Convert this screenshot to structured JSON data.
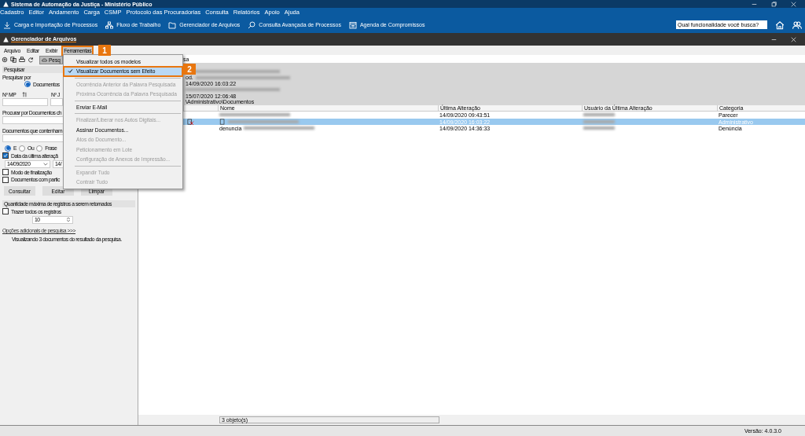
{
  "app": {
    "title": "Sistema de Automação da Justiça - Ministério Público"
  },
  "menu": [
    "Cadastro",
    "Editor",
    "Andamento",
    "Carga",
    "CSMP",
    "Protocolo das Procuradorias",
    "Consulta",
    "Relatórios",
    "Apoio",
    "Ajuda"
  ],
  "toolbar": [
    {
      "label": "Carga e Importação de Processos",
      "kind": "import"
    },
    {
      "label": "Fluxo de Trabalho",
      "kind": "flow"
    },
    {
      "label": "Gerenciador de Arquivos",
      "kind": "folder"
    },
    {
      "label": "Consulta Avançada de Processos",
      "kind": "search"
    },
    {
      "label": "Agenda de Compromissos",
      "kind": "calendar"
    }
  ],
  "search": {
    "placeholder": "Qual funcionalidade você busca?"
  },
  "child_window": {
    "title": "Gerenciador de Arquivos",
    "tool_label": "Pesq",
    "menu": [
      {
        "label": "Arquivo",
        "selected": false
      },
      {
        "label": "Editar",
        "selected": false
      },
      {
        "label": "Exibir",
        "selected": false
      },
      {
        "label": "Ferramentas",
        "selected": true
      }
    ]
  },
  "callouts": [
    "1",
    "2"
  ],
  "tools_menu": [
    {
      "kind": "item",
      "label": "Visualizar todos os modelos",
      "disabled": false,
      "checked": false,
      "selected": false
    },
    {
      "kind": "item",
      "label": "Visualizar Documentos sem Efeito",
      "disabled": false,
      "checked": true,
      "selected": true
    },
    {
      "kind": "separator"
    },
    {
      "kind": "item",
      "label": "Ocorrência Anterior da Palavra Pesquisada",
      "disabled": true,
      "checked": false,
      "selected": false
    },
    {
      "kind": "item",
      "label": "Próxima Ocorrência da Palavra Pesquisada",
      "disabled": true,
      "checked": false,
      "selected": false
    },
    {
      "kind": "separator"
    },
    {
      "kind": "item",
      "label": "Enviar E-Mail",
      "disabled": false,
      "checked": false,
      "selected": false
    },
    {
      "kind": "separator"
    },
    {
      "kind": "item",
      "label": "Finalizar/Liberar nos Autos Digitais...",
      "disabled": true,
      "checked": false,
      "selected": false
    },
    {
      "kind": "item",
      "label": "Assinar Documentos...",
      "disabled": false,
      "checked": false,
      "selected": false
    },
    {
      "kind": "item",
      "label": "Atos do Documento...",
      "disabled": true,
      "checked": false,
      "selected": false
    },
    {
      "kind": "item",
      "label": "Peticionamento em Lote",
      "disabled": true,
      "checked": false,
      "selected": false
    },
    {
      "kind": "item",
      "label": "Configuração de Anexos de Impressão...",
      "disabled": true,
      "checked": false,
      "selected": false
    },
    {
      "kind": "separator"
    },
    {
      "kind": "item",
      "label": "Expandir Tudo",
      "disabled": true,
      "checked": false,
      "selected": false
    },
    {
      "kind": "item",
      "label": "Contrair Tudo",
      "disabled": true,
      "checked": false,
      "selected": false
    }
  ],
  "search_panel": {
    "header": "Pesquisar",
    "group_label": "Pesquisar por",
    "search_by": [
      {
        "label": "Documentos",
        "selected": true
      }
    ],
    "mp_label": "Nº MP",
    "j_label": "Nº J",
    "contains_label": "Procurar por Documentos ch",
    "words_label": "Documentos que contenham",
    "modes": [
      {
        "label": "E",
        "selected": true
      },
      {
        "label": "Ou",
        "selected": false
      },
      {
        "label": "Frase",
        "selected": false
      }
    ],
    "date_check": {
      "label": "Data da última alteraçã",
      "checked": true
    },
    "date_from": "14/09/2020",
    "date_to": "14/",
    "checks": [
      {
        "label": "Modo de finalização",
        "checked": false
      },
      {
        "label": "Documentos com partic",
        "checked": false
      }
    ],
    "buttons": [
      "Consultar",
      "Editar",
      "Limpar"
    ],
    "max_header": "Quantidade máxima de registros a serem retornados",
    "all_records": {
      "label": "Trazer todos os registros",
      "checked": false
    },
    "max_value": "10",
    "more_link": "Opções adicionais de pesquisa >>>",
    "result_text": "Visualizando 3 documentos do resultado da pesquisa."
  },
  "search_strip": "sa",
  "details": [
    {
      "redacted": true
    },
    {
      "text": "od.",
      "redacted": true
    },
    {
      "text": "14/09/2020 16:03:22",
      "redacted": false
    },
    {
      "redacted": true
    },
    {
      "text": "15/07/2020 12:06:48",
      "redacted": false
    },
    {
      "text": "\\Administrativo\\Documentos",
      "redacted": false
    }
  ],
  "table": {
    "columns": [
      "Nome",
      "Última Alteração",
      "Usuário da Última Alteração",
      "Categoria"
    ],
    "rows": [
      {
        "date": "14/09/2020 09:43:51",
        "category": "Parecer",
        "selected": false,
        "no_effect": false,
        "doc_icon": false
      },
      {
        "date": "14/09/2020 16:03:22",
        "category": "Administrativo",
        "selected": true,
        "no_effect": true,
        "doc_icon": true
      },
      {
        "name": "denuncia",
        "date": "14/09/2020 14:36:33",
        "category": "Denúncia",
        "selected": false,
        "no_effect": false,
        "doc_icon": false
      }
    ]
  },
  "status": "3 objeto(s)",
  "version": "Versão: 4.0.3.0"
}
